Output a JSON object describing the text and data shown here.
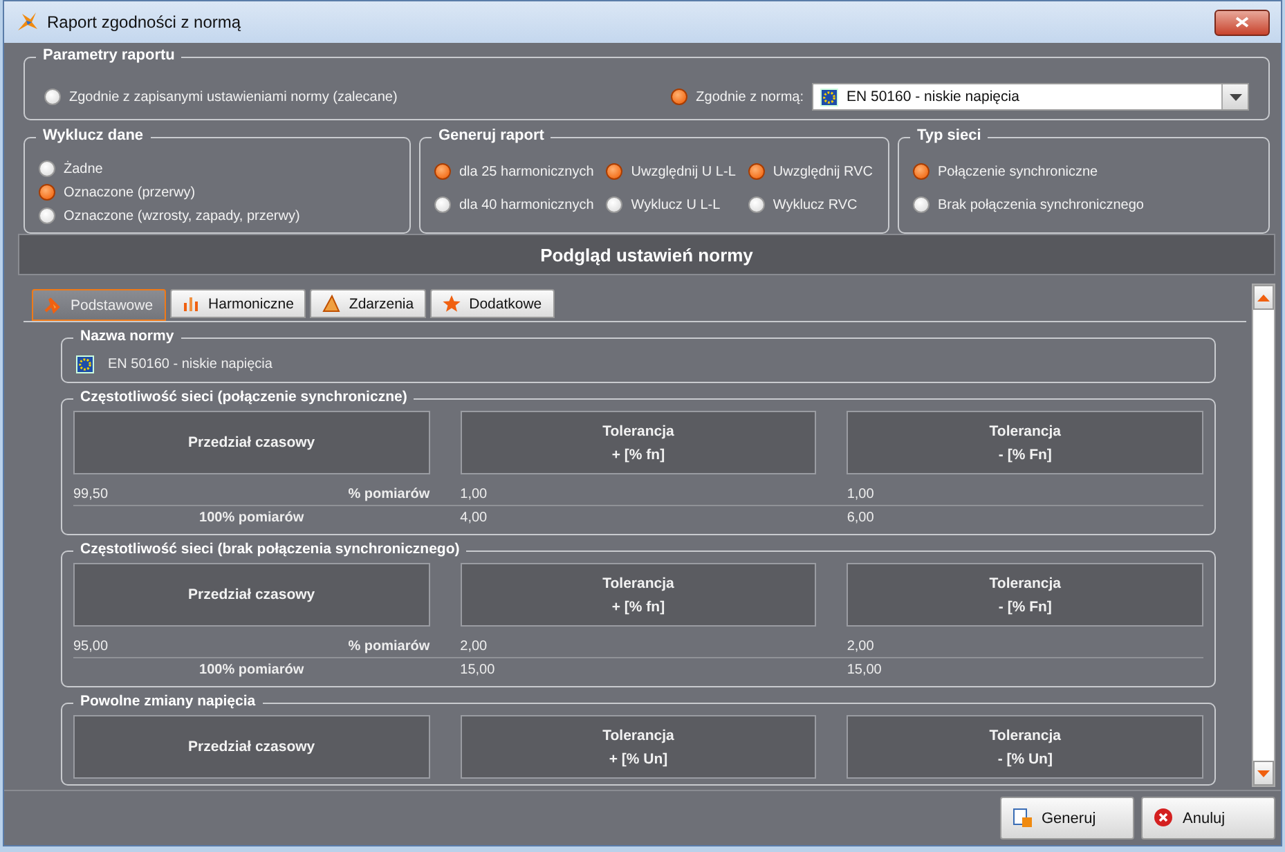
{
  "window": {
    "title": "Raport zgodności z normą"
  },
  "report_params": {
    "title": "Parametry raportu",
    "options": [
      {
        "label": "Zgodnie z zapisanymi ustawieniami normy (zalecane)",
        "selected": false
      },
      {
        "label": "Zgodnie z normą:",
        "selected": true
      }
    ],
    "norm_dropdown": {
      "value": "EN 50160 - niskie napięcia"
    }
  },
  "exclude_data": {
    "title": "Wyklucz dane",
    "options": [
      {
        "label": "Żadne",
        "selected": false
      },
      {
        "label": "Oznaczone (przerwy)",
        "selected": true
      },
      {
        "label": "Oznaczone (wzrosty, zapady, przerwy)",
        "selected": false
      }
    ]
  },
  "generate_report": {
    "title": "Generuj raport",
    "options": [
      {
        "label": "dla 25 harmonicznych",
        "selected": true
      },
      {
        "label": "Uwzględnij U L-L",
        "selected": true
      },
      {
        "label": "Uwzględnij RVC",
        "selected": true
      },
      {
        "label": "dla 40 harmonicznych",
        "selected": false
      },
      {
        "label": "Wyklucz U L-L",
        "selected": false
      },
      {
        "label": "Wyklucz RVC",
        "selected": false
      }
    ]
  },
  "network_type": {
    "title": "Typ sieci",
    "options": [
      {
        "label": "Połączenie synchroniczne",
        "selected": true
      },
      {
        "label": "Brak połączenia synchronicznego",
        "selected": false
      }
    ]
  },
  "preview": {
    "title": "Podgląd ustawień normy",
    "tabs": [
      {
        "label": "Podstawowe",
        "selected": true
      },
      {
        "label": "Harmoniczne",
        "selected": false
      },
      {
        "label": "Zdarzenia",
        "selected": false
      },
      {
        "label": "Dodatkowe",
        "selected": false
      }
    ],
    "norm_name": {
      "title": "Nazwa normy",
      "value": "EN 50160 - niskie napięcia"
    },
    "sections": [
      {
        "title": "Częstotliwość sieci (połączenie synchroniczne)",
        "headers": [
          {
            "line1": "Przedział czasowy"
          },
          {
            "line1": "Tolerancja",
            "line2": "+ [% fn]"
          },
          {
            "line1": "Tolerancja",
            "line2": "- [% Fn]"
          }
        ],
        "rows": [
          {
            "value": "99,50",
            "label": "% pomiarów",
            "cells": [
              "1,00",
              "1,00"
            ]
          },
          {
            "label": "100% pomiarów",
            "cells": [
              "4,00",
              "6,00"
            ]
          }
        ]
      },
      {
        "title": "Częstotliwość sieci (brak połączenia synchronicznego)",
        "headers": [
          {
            "line1": "Przedział czasowy"
          },
          {
            "line1": "Tolerancja",
            "line2": "+ [% fn]"
          },
          {
            "line1": "Tolerancja",
            "line2": "- [% Fn]"
          }
        ],
        "rows": [
          {
            "value": "95,00",
            "label": "% pomiarów",
            "cells": [
              "2,00",
              "2,00"
            ]
          },
          {
            "label": "100% pomiarów",
            "cells": [
              "15,00",
              "15,00"
            ]
          }
        ]
      },
      {
        "title": "Powolne zmiany napięcia",
        "headers": [
          {
            "line1": "Przedział czasowy"
          },
          {
            "line1": "Tolerancja",
            "line2": "+ [% Un]"
          },
          {
            "line1": "Tolerancja",
            "line2": "- [% Un]"
          }
        ]
      }
    ]
  },
  "buttons": [
    {
      "label": "Generuj",
      "kind": "generate"
    },
    {
      "label": "Anuluj",
      "kind": "cancel"
    }
  ]
}
